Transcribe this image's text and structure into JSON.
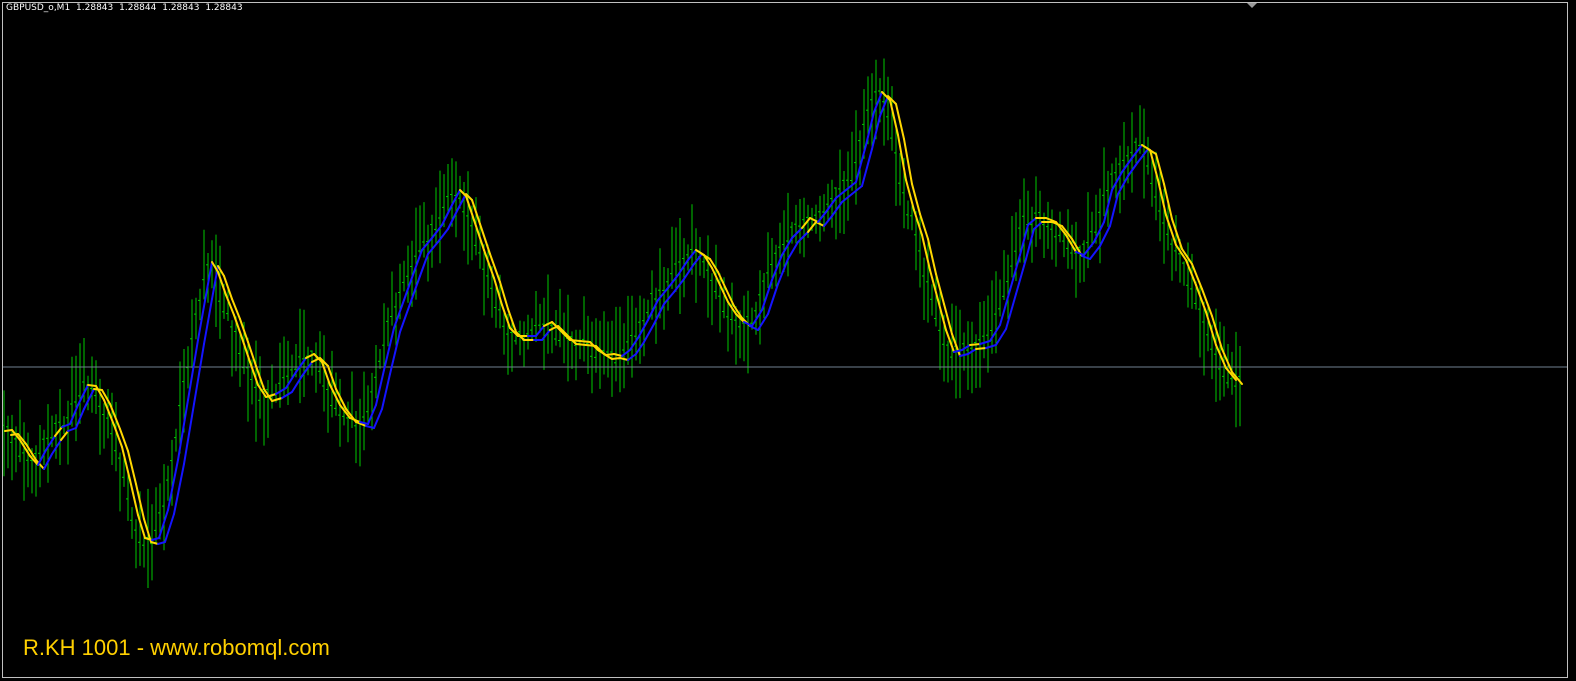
{
  "header": {
    "symbol": "GBPUSD_o,M1",
    "open": "1.28843",
    "high": "1.28844",
    "low": "1.28843",
    "close": "1.28843"
  },
  "watermark": {
    "text": "R.KH 1001 - www.robomql.com",
    "color": "#ffd000"
  },
  "colors": {
    "background": "#000000",
    "bars": "#00c800",
    "up_line": "#1414ff",
    "down_line": "#ffd700",
    "bid_line": "#708090"
  },
  "chart_data": {
    "type": "line",
    "title": "",
    "xlabel": "",
    "ylabel": "",
    "grid": false,
    "bid_price": "1.28843",
    "series": [
      {
        "name": "",
        "type": "ohlc-bars",
        "style": "green vertical bars"
      },
      {
        "name": "",
        "type": "line",
        "style": "blue (rising) / yellow (falling) double line"
      }
    ]
  }
}
